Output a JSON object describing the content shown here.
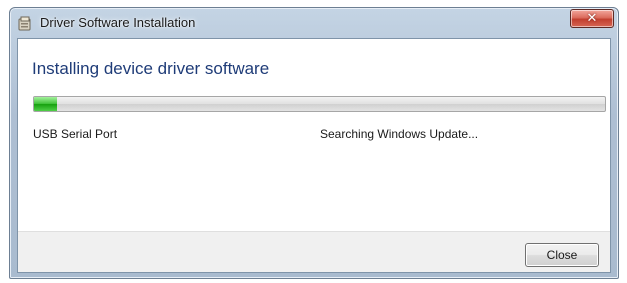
{
  "window": {
    "title": "Driver Software Installation",
    "close_glyph": "✕",
    "title_icon": "installer-icon"
  },
  "main": {
    "heading": "Installing device driver software",
    "progress_percent": 4,
    "device": {
      "name": "USB Serial Port",
      "status": "Searching Windows Update..."
    }
  },
  "footer": {
    "close_label": "Close"
  },
  "colors": {
    "heading": "#1f3c78",
    "progress_green": "#17a10f",
    "close_red": "#c23f2f"
  }
}
